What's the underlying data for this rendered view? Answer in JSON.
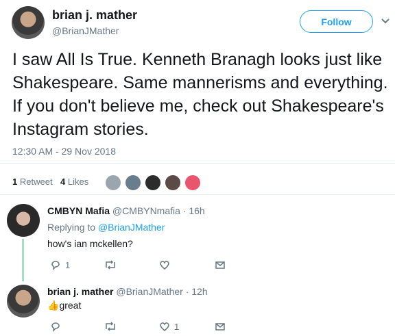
{
  "tweet": {
    "author_name": "brian j. mather",
    "author_handle": "@BrianJMather",
    "follow_label": "Follow",
    "text": "I saw All Is True.  Kenneth Branagh looks just like Shakespeare.  Same mannerisms and everything.  If you don't believe me, check out Shakespeare's Instagram stories.",
    "timestamp": "12:30 AM - 29 Nov 2018",
    "retweets_count": "1",
    "retweets_label": "Retweet",
    "likes_count": "4",
    "likes_label": "Likes"
  },
  "replies": [
    {
      "author_name": "CMBYN Mafia",
      "author_handle": "@CMBYNmafia",
      "time": "· 16h",
      "replying_to_label": "Replying to",
      "replying_to_handle": "@BrianJMather",
      "text": "how's ian mckellen?",
      "retweet_count": "",
      "reply_count": "1",
      "like_count": ""
    },
    {
      "author_name": "brian j. mather",
      "author_handle": "@BrianJMather",
      "time": "· 12h",
      "text": "great",
      "emoji": "👍",
      "reply_count": "",
      "like_count": "1"
    }
  ],
  "colors": {
    "accent": "#1da1f2",
    "muted": "#657786",
    "divider": "#e6ecf0",
    "thread_line": "#a3e0c8"
  }
}
